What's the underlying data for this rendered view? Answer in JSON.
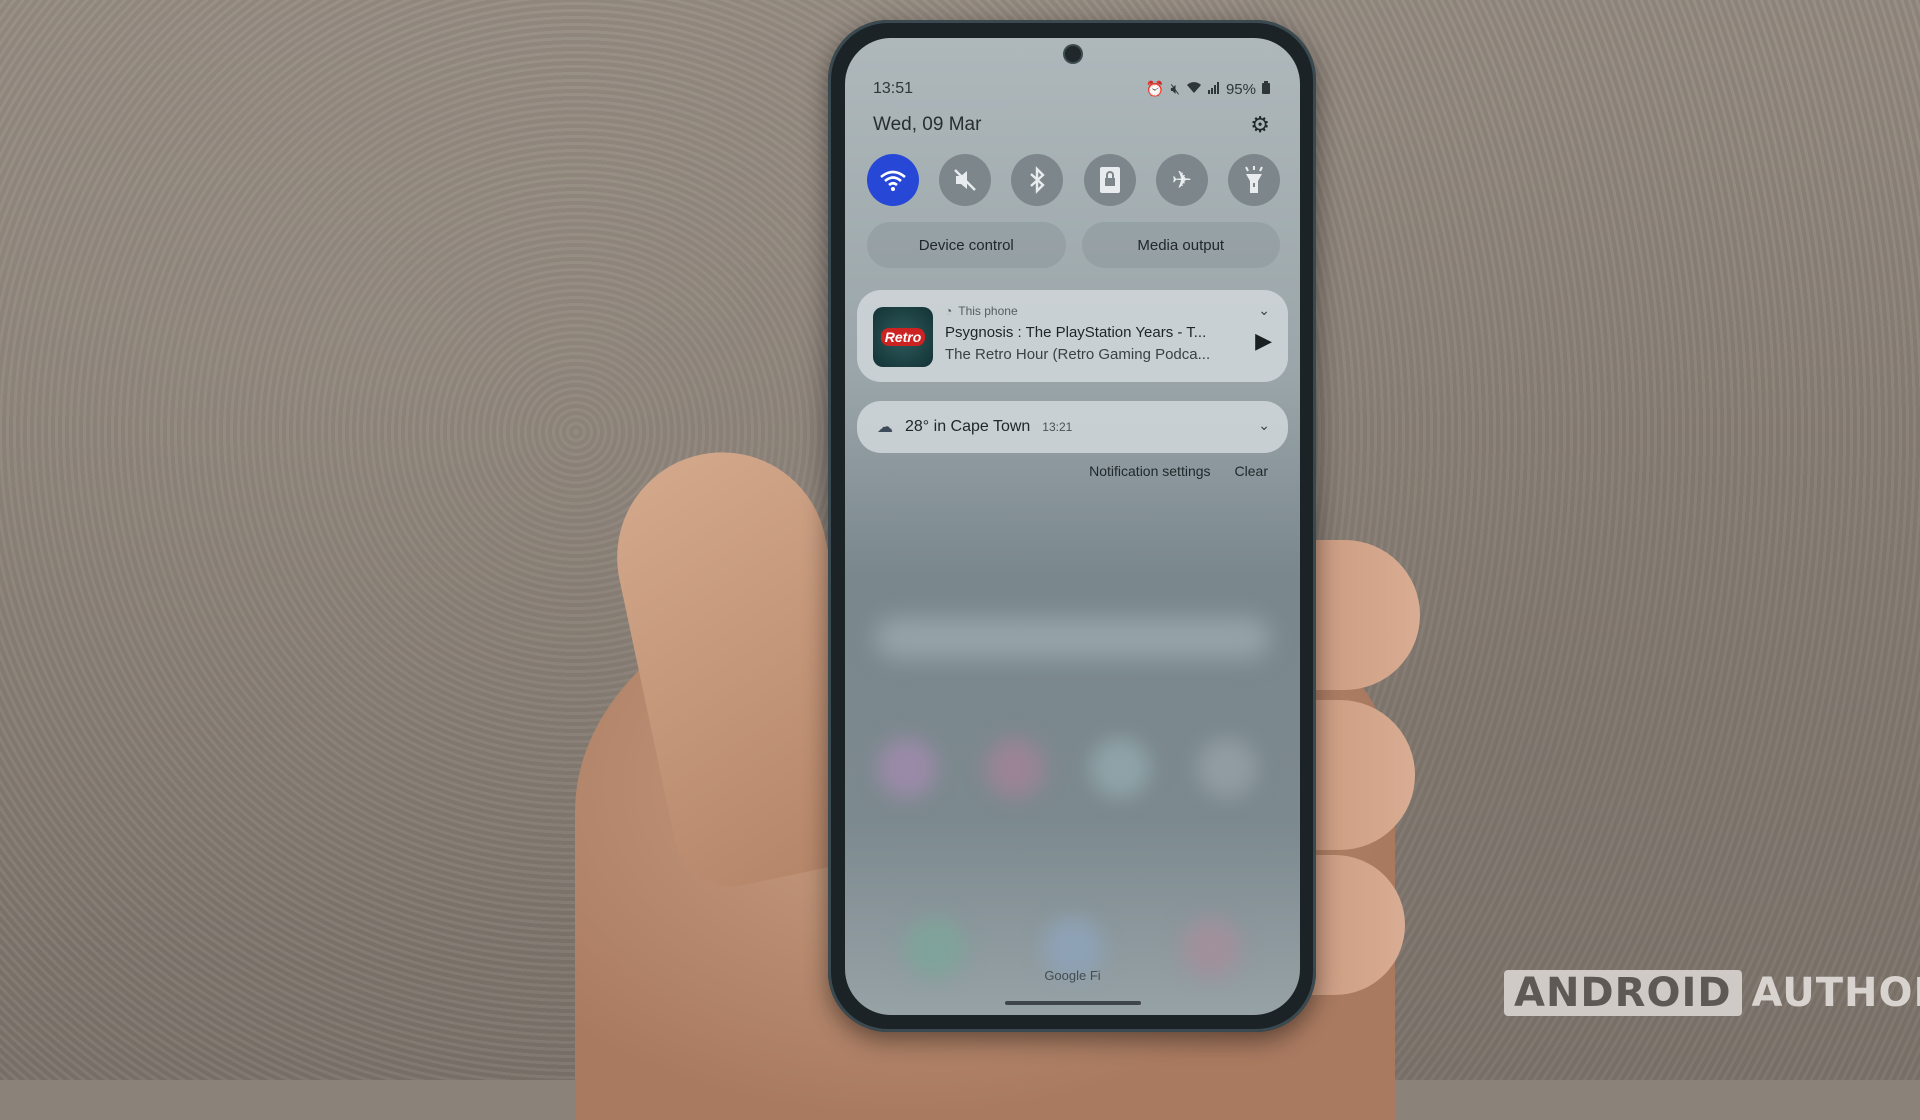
{
  "status_bar": {
    "time": "13:51",
    "icons": [
      "alarm-icon",
      "mute-icon",
      "wifi-icon",
      "signal-icon"
    ],
    "battery": "95%"
  },
  "header": {
    "date": "Wed, 09 Mar",
    "settings_icon": "gear-icon"
  },
  "quick_toggles": [
    {
      "name": "wifi",
      "icon": "wifi-icon",
      "active": true
    },
    {
      "name": "sound",
      "icon": "mute-icon",
      "active": false
    },
    {
      "name": "bluetooth",
      "icon": "bluetooth-icon",
      "active": false
    },
    {
      "name": "auto-rotate-lock",
      "icon": "rotation-lock-icon",
      "active": false
    },
    {
      "name": "airplane-mode",
      "icon": "airplane-icon",
      "active": false
    },
    {
      "name": "flashlight",
      "icon": "flashlight-icon",
      "active": false
    }
  ],
  "accent_color": "#2748d6",
  "pills": {
    "device_control": "Device control",
    "media_output": "Media output"
  },
  "media": {
    "source": "This phone",
    "title": "Psygnosis : The PlayStation Years - T...",
    "subtitle": "The Retro Hour (Retro Gaming Podca...",
    "art_label": "Retro"
  },
  "weather": {
    "text": "28° in Cape Town",
    "time": "13:21"
  },
  "notification_actions": {
    "settings": "Notification settings",
    "clear": "Clear"
  },
  "carrier": "Google Fi",
  "watermark": {
    "part1": "ANDROID",
    "part2": "AUTHORITY"
  }
}
